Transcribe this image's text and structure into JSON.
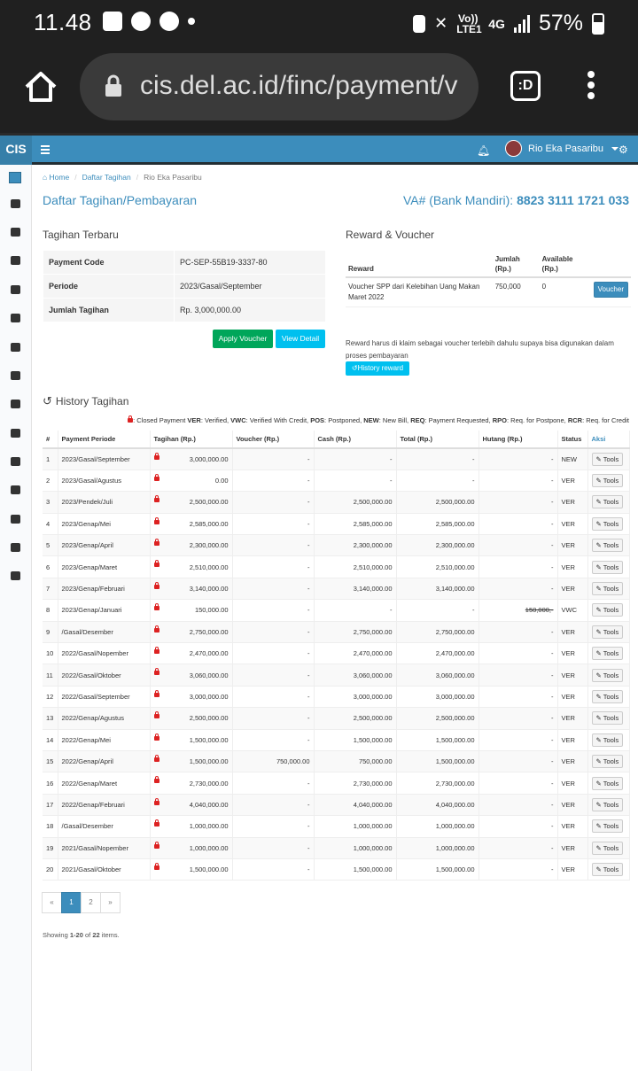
{
  "status_bar": {
    "time": "11.48",
    "network": "4G",
    "lte": "Vo)) LTE1",
    "battery": "57%"
  },
  "browser": {
    "url": "cis.del.ac.id/finc/payment/v",
    "tab_label": ":D"
  },
  "app": {
    "logo": "CIS",
    "user_name": "Rio Eka Pasaribu"
  },
  "breadcrumb": {
    "home": "Home",
    "level1": "Daftar Tagihan",
    "current": "Rio Eka Pasaribu"
  },
  "page": {
    "title": "Daftar Tagihan/Pembayaran",
    "va_label": "VA# (Bank Mandiri):",
    "va_number": "8823 3111 1721 033"
  },
  "tagihan_terbaru": {
    "title": "Tagihan Terbaru",
    "rows": [
      {
        "label": "Payment Code",
        "value": "PC-SEP-55B19-3337-80"
      },
      {
        "label": "Periode",
        "value": "2023/Gasal/September"
      },
      {
        "label": "Jumlah Tagihan",
        "value": "Rp. 3,000,000.00"
      }
    ],
    "apply_voucher": "Apply Voucher",
    "view_detail": "View Detail"
  },
  "reward": {
    "title": "Reward & Voucher",
    "headers": [
      "Reward",
      "Jumlah (Rp.)",
      "Available (Rp.)"
    ],
    "row": {
      "reward": "Voucher SPP dari Kelebihan Uang Makan Maret 2022",
      "jumlah": "750,000",
      "available": "0",
      "button": "Voucher"
    },
    "note": "Reward harus di klaim sebagai voucher terlebih dahulu supaya bisa digunakan dalam proses pembayaran",
    "history_button": "History reward"
  },
  "history": {
    "title": "History Tagihan",
    "legend": [
      {
        "code": "",
        "desc": ": Closed Payment "
      },
      {
        "code": "VER",
        "desc": ": Verified, "
      },
      {
        "code": "VWC",
        "desc": ": Verified With Credit, "
      },
      {
        "code": "POS",
        "desc": ": Postponed, "
      },
      {
        "code": "NEW",
        "desc": ": New Bill, "
      },
      {
        "code": "REQ",
        "desc": ": Payment Requested, "
      },
      {
        "code": "RPO",
        "desc": ": Req. for Postpone, "
      },
      {
        "code": "RCR",
        "desc": ": Req. for Credit"
      }
    ],
    "headers": [
      "#",
      "Payment Periode",
      "Tagihan (Rp.)",
      "Voucher (Rp.)",
      "Cash (Rp.)",
      "Total (Rp.)",
      "Hutang (Rp.)",
      "Status",
      "Aksi"
    ],
    "tools_label": "Tools",
    "rows": [
      [
        "1",
        "2023/Gasal/September",
        "3,000,000.00",
        "-",
        "-",
        "-",
        "-",
        "NEW"
      ],
      [
        "2",
        "2023/Gasal/Agustus",
        "0.00",
        "-",
        "-",
        "-",
        "-",
        "VER"
      ],
      [
        "3",
        "2023/Pendek/Juli",
        "2,500,000.00",
        "-",
        "2,500,000.00",
        "2,500,000.00",
        "-",
        "VER"
      ],
      [
        "4",
        "2023/Genap/Mei",
        "2,585,000.00",
        "-",
        "2,585,000.00",
        "2,585,000.00",
        "-",
        "VER"
      ],
      [
        "5",
        "2023/Genap/April",
        "2,300,000.00",
        "-",
        "2,300,000.00",
        "2,300,000.00",
        "-",
        "VER"
      ],
      [
        "6",
        "2023/Genap/Maret",
        "2,510,000.00",
        "-",
        "2,510,000.00",
        "2,510,000.00",
        "-",
        "VER"
      ],
      [
        "7",
        "2023/Genap/Februari",
        "3,140,000.00",
        "-",
        "3,140,000.00",
        "3,140,000.00",
        "-",
        "VER"
      ],
      [
        "8",
        "2023/Genap/Januari",
        "150,000.00",
        "-",
        "-",
        "-",
        "150,000,-",
        "VWC"
      ],
      [
        "9",
        "/Gasal/Desember",
        "2,750,000.00",
        "-",
        "2,750,000.00",
        "2,750,000.00",
        "-",
        "VER"
      ],
      [
        "10",
        "2022/Gasal/Nopember",
        "2,470,000.00",
        "-",
        "2,470,000.00",
        "2,470,000.00",
        "-",
        "VER"
      ],
      [
        "11",
        "2022/Gasal/Oktober",
        "3,060,000.00",
        "-",
        "3,060,000.00",
        "3,060,000.00",
        "-",
        "VER"
      ],
      [
        "12",
        "2022/Gasal/September",
        "3,000,000.00",
        "-",
        "3,000,000.00",
        "3,000,000.00",
        "-",
        "VER"
      ],
      [
        "13",
        "2022/Genap/Agustus",
        "2,500,000.00",
        "-",
        "2,500,000.00",
        "2,500,000.00",
        "-",
        "VER"
      ],
      [
        "14",
        "2022/Genap/Mei",
        "1,500,000.00",
        "-",
        "1,500,000.00",
        "1,500,000.00",
        "-",
        "VER"
      ],
      [
        "15",
        "2022/Genap/April",
        "1,500,000.00",
        "750,000.00",
        "750,000.00",
        "1,500,000.00",
        "-",
        "VER"
      ],
      [
        "16",
        "2022/Genap/Maret",
        "2,730,000.00",
        "-",
        "2,730,000.00",
        "2,730,000.00",
        "-",
        "VER"
      ],
      [
        "17",
        "2022/Genap/Februari",
        "4,040,000.00",
        "-",
        "4,040,000.00",
        "4,040,000.00",
        "-",
        "VER"
      ],
      [
        "18",
        "/Gasal/Desember",
        "1,000,000.00",
        "-",
        "1,000,000.00",
        "1,000,000.00",
        "-",
        "VER"
      ],
      [
        "19",
        "2021/Gasal/Nopember",
        "1,000,000.00",
        "-",
        "1,000,000.00",
        "1,000,000.00",
        "-",
        "VER"
      ],
      [
        "20",
        "2021/Gasal/Oktober",
        "1,500,000.00",
        "-",
        "1,500,000.00",
        "1,500,000.00",
        "-",
        "VER"
      ]
    ]
  },
  "pagination": {
    "prev": "«",
    "pages": [
      "1",
      "2"
    ],
    "active": "1",
    "next": "»"
  },
  "summary": {
    "prefix": "Showing ",
    "range": "1-20",
    "of": " of ",
    "total": "22",
    "suffix": " items."
  }
}
